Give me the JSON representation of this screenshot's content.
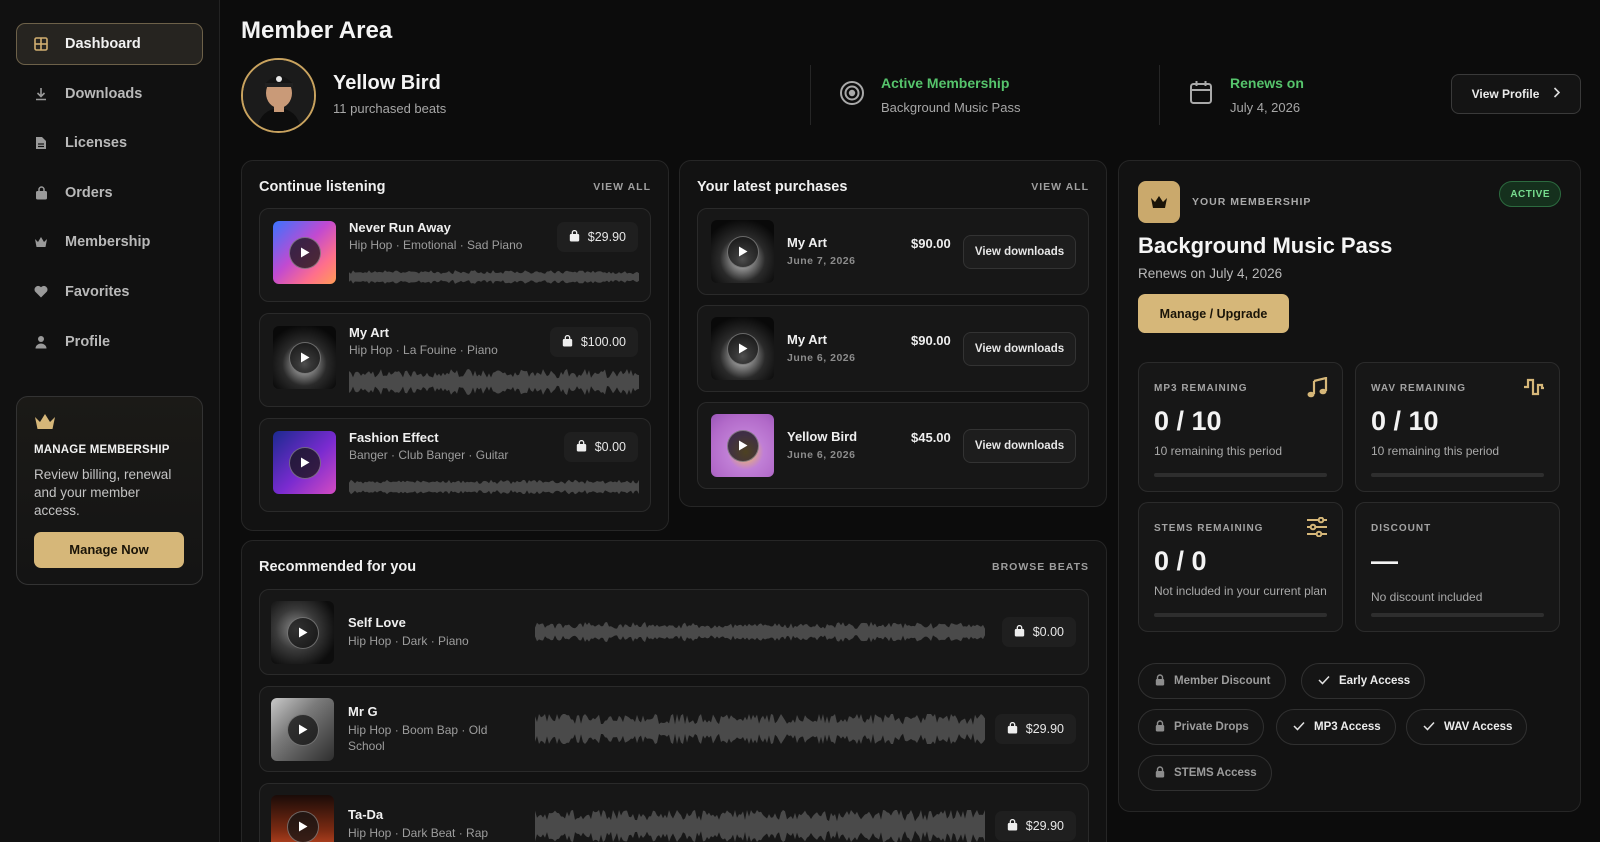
{
  "sidebar": {
    "items": [
      {
        "label": "Dashboard",
        "icon": "grid-icon",
        "active": true
      },
      {
        "label": "Downloads",
        "icon": "download-icon"
      },
      {
        "label": "Licenses",
        "icon": "document-icon"
      },
      {
        "label": "Orders",
        "icon": "bag-icon"
      },
      {
        "label": "Membership",
        "icon": "crown-icon"
      },
      {
        "label": "Favorites",
        "icon": "heart-icon"
      },
      {
        "label": "Profile",
        "icon": "user-icon"
      }
    ],
    "manage": {
      "title": "MANAGE MEMBERSHIP",
      "description": "Review billing, renewal and your member access.",
      "button": "Manage Now"
    }
  },
  "header": {
    "title": "Member Area",
    "user_name": "Yellow Bird",
    "user_sub": "11 purchased beats",
    "membership_status_title": "Active Membership",
    "membership_status_value": "Background Music Pass",
    "renews_title": "Renews on",
    "renews_value": "July 4, 2026",
    "view_profile": "View Profile"
  },
  "continue": {
    "title": "Continue listening",
    "link": "VIEW ALL",
    "tracks": [
      {
        "title": "Never Run Away",
        "meta": "Hip Hop · Emotional · Sad Piano",
        "price": "$29.90"
      },
      {
        "title": "My Art",
        "meta": "Hip Hop · La Fouine · Piano",
        "price": "$100.00"
      },
      {
        "title": "Fashion Effect",
        "meta": "Banger · Club Banger · Guitar",
        "price": "$0.00"
      }
    ]
  },
  "purchases": {
    "title": "Your latest purchases",
    "link": "VIEW ALL",
    "items": [
      {
        "title": "My Art",
        "date": "June 7, 2026",
        "price": "$90.00",
        "button": "View downloads"
      },
      {
        "title": "My Art",
        "date": "June 6, 2026",
        "price": "$90.00",
        "button": "View downloads"
      },
      {
        "title": "Yellow Bird",
        "date": "June 6, 2026",
        "price": "$45.00",
        "button": "View downloads"
      }
    ]
  },
  "recommended": {
    "title": "Recommended for you",
    "link": "BROWSE BEATS",
    "tracks": [
      {
        "title": "Self Love",
        "meta": "Hip Hop · Dark · Piano",
        "price": "$0.00"
      },
      {
        "title": "Mr G",
        "meta": "Hip Hop · Boom Bap · Old School",
        "price": "$29.90"
      },
      {
        "title": "Ta-Da",
        "meta": "Hip Hop · Dark Beat · Rap",
        "price": "$29.90"
      }
    ]
  },
  "membership": {
    "label": "YOUR MEMBERSHIP",
    "status": "ACTIVE",
    "name": "Background Music Pass",
    "renews": "Renews on July 4, 2026",
    "button": "Manage / Upgrade",
    "stats": [
      {
        "label": "MP3 REMAINING",
        "value": "0 / 10",
        "note": "10 remaining this period",
        "progress": 0,
        "icon": "music-note-icon"
      },
      {
        "label": "WAV REMAINING",
        "value": "0 / 10",
        "note": "10 remaining this period",
        "progress": 0,
        "icon": "waveform-icon"
      },
      {
        "label": "STEMS REMAINING",
        "value": "0 / 0",
        "note": "Not included in your current plan",
        "progress": 0,
        "icon": "sliders-icon"
      },
      {
        "label": "DISCOUNT",
        "value": "—",
        "note": "No discount included",
        "progress": 0
      }
    ],
    "perks": [
      {
        "label": "Member Discount",
        "included": false
      },
      {
        "label": "Early Access",
        "included": true
      },
      {
        "label": "Private Drops",
        "included": false
      },
      {
        "label": "MP3 Access",
        "included": true
      },
      {
        "label": "WAV Access",
        "included": true
      },
      {
        "label": "STEMS Access",
        "included": false
      }
    ]
  },
  "colors": {
    "accent_gold": "#d6b779",
    "active_green": "#56c46c",
    "background": "#0c0c0c"
  }
}
